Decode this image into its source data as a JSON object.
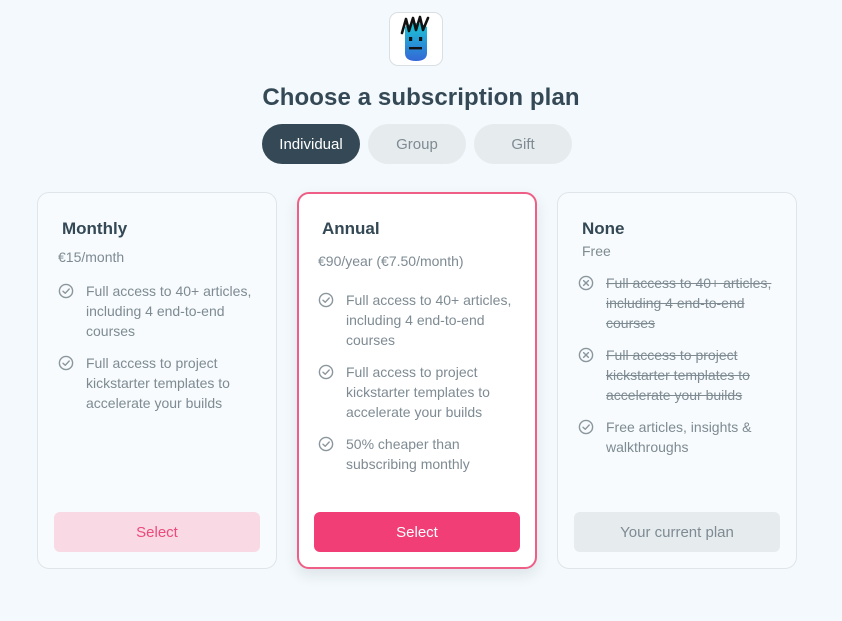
{
  "header": {
    "logo_icon": "character-logo-icon",
    "title": "Choose a subscription plan"
  },
  "tabs": [
    {
      "label": "Individual",
      "active": true
    },
    {
      "label": "Group",
      "active": false
    },
    {
      "label": "Gift",
      "active": false
    }
  ],
  "plans": [
    {
      "name": "Monthly",
      "price": "€15/month",
      "features": [
        {
          "text": "Full access to 40+ articles, including 4 end-to-end courses",
          "icon": "check-circle-icon",
          "included": true
        },
        {
          "text": "Full access to project kickstarter templates to accelerate your builds",
          "icon": "check-circle-icon",
          "included": true
        }
      ],
      "button": "Select"
    },
    {
      "name": "Annual",
      "price": "€90/year (€7.50/month)",
      "features": [
        {
          "text": "Full access to 40+ articles, including 4 end-to-end courses",
          "icon": "check-circle-icon",
          "included": true
        },
        {
          "text": "Full access to project kickstarter templates to accelerate your builds",
          "icon": "check-circle-icon",
          "included": true
        },
        {
          "text": "50% cheaper than subscribing monthly",
          "icon": "check-circle-icon",
          "included": true
        }
      ],
      "button": "Select"
    },
    {
      "name": "None",
      "price": "Free",
      "features": [
        {
          "text": "Full access to 40+ articles, including 4 end-to-end courses",
          "icon": "x-circle-icon",
          "included": false
        },
        {
          "text": "Full access to project kickstarter templates to accelerate your builds",
          "icon": "x-circle-icon",
          "included": false
        },
        {
          "text": "Free articles, insights & walkthroughs",
          "icon": "check-circle-icon",
          "included": true
        }
      ],
      "button": "Your current plan"
    }
  ],
  "colors": {
    "accent": "#f23e76",
    "accent_light": "#f9d9e4",
    "dark": "#344955",
    "muted": "#7e8b93",
    "background": "#f3f9fc"
  }
}
